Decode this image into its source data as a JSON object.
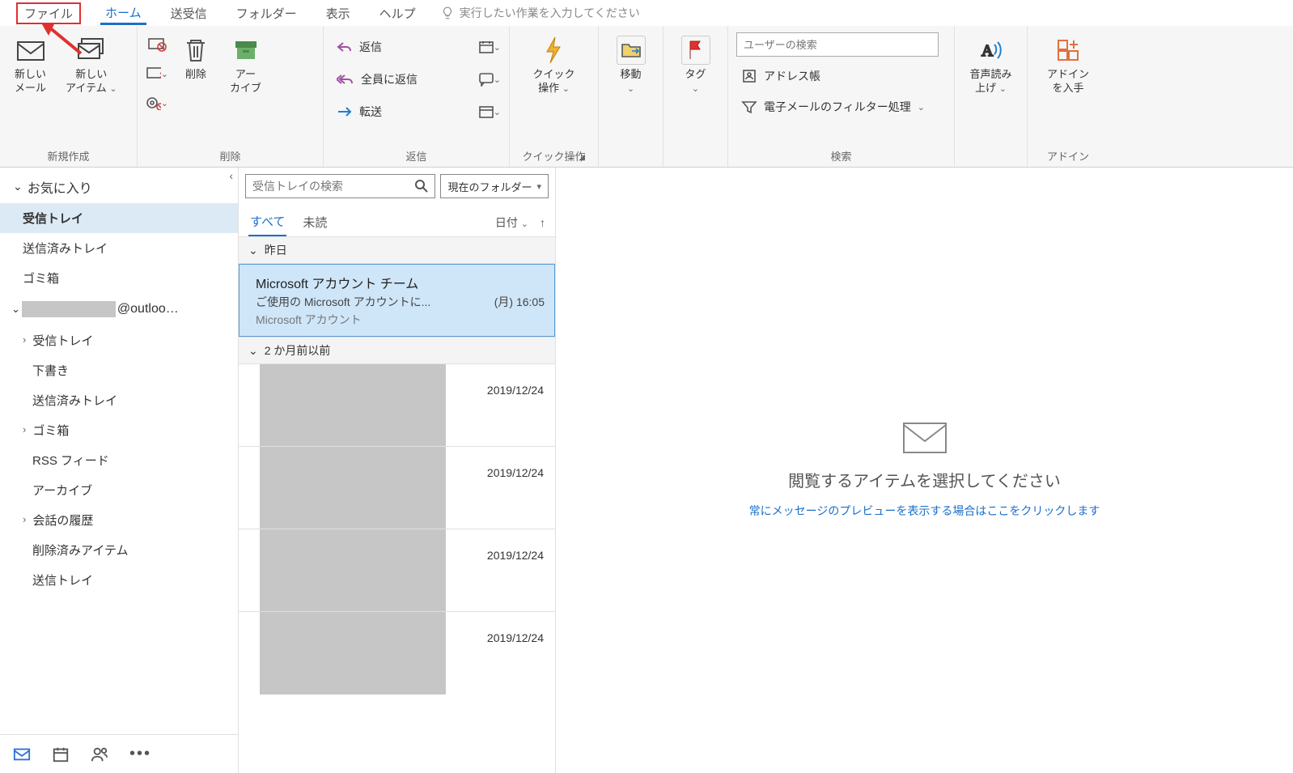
{
  "tabs": {
    "file": "ファイル",
    "home": "ホーム",
    "sendrecv": "送受信",
    "folder": "フォルダー",
    "view": "表示",
    "help": "ヘルプ",
    "tellme": "実行したい作業を入力してください"
  },
  "ribbon": {
    "new_group": "新規作成",
    "new_mail": "新しい\nメール",
    "new_item": "新しい\nアイテム",
    "delete_group": "削除",
    "delete": "削除",
    "archive": "アー\nカイブ",
    "reply_group": "返信",
    "reply": "返信",
    "reply_all": "全員に返信",
    "forward": "転送",
    "quick_group": "クイック操作",
    "quick": "クイック\n操作",
    "move": "移動",
    "tag": "タグ",
    "search_group": "検索",
    "search_placeholder": "ユーザーの検索",
    "addressbook": "アドレス帳",
    "filter": "電子メールのフィルター処理",
    "speech": "音声読み\n上げ",
    "addin_group": "アドイン",
    "addin": "アドイン\nを入手"
  },
  "folderpane": {
    "favorites": "お気に入り",
    "fav_items": [
      "受信トレイ",
      "送信済みトレイ",
      "ゴミ箱"
    ],
    "account_suffix": "@outloo…",
    "folders": [
      {
        "label": "受信トレイ",
        "expandable": true
      },
      {
        "label": "下書き"
      },
      {
        "label": "送信済みトレイ"
      },
      {
        "label": "ゴミ箱",
        "expandable": true
      },
      {
        "label": "RSS フィード"
      },
      {
        "label": "アーカイブ"
      },
      {
        "label": "会話の履歴",
        "expandable": true
      },
      {
        "label": "削除済みアイテム"
      },
      {
        "label": "送信トレイ"
      }
    ]
  },
  "msglist": {
    "search_placeholder": "受信トレイの検索",
    "scope": "現在のフォルダー",
    "filter_all": "すべて",
    "filter_unread": "未読",
    "sort": "日付",
    "group1": "昨日",
    "group2": "2 か月前以前",
    "item1": {
      "from": "Microsoft アカウント チーム",
      "subj": "ご使用の Microsoft アカウントに...",
      "time": "(月) 16:05",
      "preview": "Microsoft アカウント"
    },
    "redacted_dates": [
      "2019/12/24",
      "2019/12/24",
      "2019/12/24",
      "2019/12/24"
    ]
  },
  "reading": {
    "prompt": "閲覧するアイテムを選択してください",
    "link": "常にメッセージのプレビューを表示する場合はここをクリックします"
  }
}
